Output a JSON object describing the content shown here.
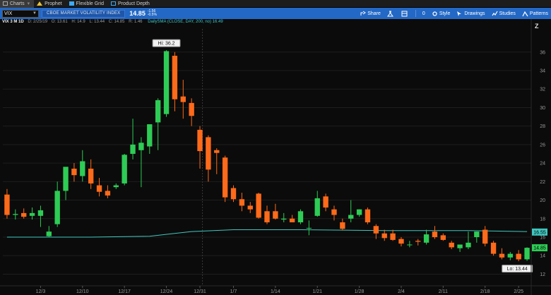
{
  "tabs": [
    {
      "label": "Charts",
      "icon": "charts-icon",
      "active": true
    },
    {
      "label": "Prophet",
      "icon": "warning-icon",
      "active": false
    },
    {
      "label": "Flexible Grid",
      "icon": "grid-icon",
      "active": false
    },
    {
      "label": "Product Depth",
      "icon": "depth-icon",
      "active": false
    }
  ],
  "toolbar": {
    "symbol": "VIX",
    "description": "CBOE MARKET VOLATILITY INDEX",
    "last_price": "14.85",
    "change_top": "-1.56",
    "change_bottom": "-0.5%",
    "share": "Share",
    "count": "0",
    "style": "Style",
    "drawings": "Drawings",
    "studies": "Studies",
    "patterns": "Patterns"
  },
  "chart_header": {
    "symbol_agg": "VIX 3 M 1D",
    "date": "D: 2/25/19",
    "open": "O: 13.61",
    "high": "H: 14.9",
    "low": "L: 13.44",
    "close": "C: 14.85",
    "change": "R: 1.46",
    "sma": "DailySMA (CLOSE, DAY, 200, no) 16.49"
  },
  "colors": {
    "up": "#2ecc55",
    "down": "#ff6a1a",
    "sma": "#40c8c0",
    "grid": "#1e1e1e",
    "bg": "#0b0b0b"
  },
  "chart_data": {
    "type": "candlestick",
    "y_ticks": [
      12,
      14,
      16,
      18,
      20,
      22,
      24,
      26,
      28,
      30,
      32,
      34,
      36
    ],
    "ylim": [
      11.5,
      38.5
    ],
    "x_tick_labels": [
      {
        "label": "12/3",
        "index": 4
      },
      {
        "label": "12/10",
        "index": 9
      },
      {
        "label": "12/17",
        "index": 14
      },
      {
        "label": "12/24",
        "index": 19
      },
      {
        "label": "12/31",
        "index": 23
      },
      {
        "label": "1/7",
        "index": 27
      },
      {
        "label": "1/14",
        "index": 32
      },
      {
        "label": "1/21",
        "index": 37
      },
      {
        "label": "1/28",
        "index": 42
      },
      {
        "label": "2/4",
        "index": 47
      },
      {
        "label": "2/11",
        "index": 52
      },
      {
        "label": "2/18",
        "index": 57
      },
      {
        "label": "2/25",
        "index": 61
      }
    ],
    "candles": [
      {
        "o": 20.6,
        "h": 21.2,
        "l": 18.0,
        "c": 18.4
      },
      {
        "o": 18.4,
        "h": 19.0,
        "l": 17.9,
        "c": 18.5
      },
      {
        "o": 18.6,
        "h": 19.1,
        "l": 18.0,
        "c": 18.2
      },
      {
        "o": 18.3,
        "h": 19.2,
        "l": 17.9,
        "c": 18.6
      },
      {
        "o": 18.3,
        "h": 19.4,
        "l": 17.1,
        "c": 18.9
      },
      {
        "o": 16.1,
        "h": 17.2,
        "l": 16.0,
        "c": 16.6
      },
      {
        "o": 17.4,
        "h": 22.0,
        "l": 17.1,
        "c": 21.0
      },
      {
        "o": 21.0,
        "h": 23.2,
        "l": 20.0,
        "c": 23.6
      },
      {
        "o": 23.4,
        "h": 24.0,
        "l": 22.0,
        "c": 22.7
      },
      {
        "o": 22.6,
        "h": 25.4,
        "l": 22.0,
        "c": 24.2
      },
      {
        "o": 23.4,
        "h": 24.4,
        "l": 21.2,
        "c": 21.8
      },
      {
        "o": 21.6,
        "h": 22.4,
        "l": 20.4,
        "c": 20.9
      },
      {
        "o": 21.0,
        "h": 21.6,
        "l": 20.2,
        "c": 20.5
      },
      {
        "o": 21.4,
        "h": 21.8,
        "l": 21.2,
        "c": 21.6
      },
      {
        "o": 21.8,
        "h": 25.0,
        "l": 21.6,
        "c": 24.9
      },
      {
        "o": 25.0,
        "h": 28.8,
        "l": 24.4,
        "c": 26.0
      },
      {
        "o": 25.4,
        "h": 26.8,
        "l": 21.4,
        "c": 26.2
      },
      {
        "o": 25.8,
        "h": 27.8,
        "l": 25.0,
        "c": 28.2
      },
      {
        "o": 28.4,
        "h": 31.0,
        "l": 25.4,
        "c": 30.8
      },
      {
        "o": 29.3,
        "h": 36.2,
        "l": 29.0,
        "c": 36.1
      },
      {
        "o": 35.6,
        "h": 36.0,
        "l": 29.6,
        "c": 30.9
      },
      {
        "o": 31.2,
        "h": 33.0,
        "l": 28.8,
        "c": 30.6
      },
      {
        "o": 30.5,
        "h": 31.0,
        "l": 28.0,
        "c": 29.1
      },
      {
        "o": 27.6,
        "h": 28.0,
        "l": 23.4,
        "c": 25.3
      },
      {
        "o": 26.8,
        "h": 27.0,
        "l": 22.0,
        "c": 23.3
      },
      {
        "o": 25.4,
        "h": 25.6,
        "l": 22.8,
        "c": 25.1
      },
      {
        "o": 24.6,
        "h": 24.8,
        "l": 19.8,
        "c": 20.3
      },
      {
        "o": 21.3,
        "h": 21.6,
        "l": 19.8,
        "c": 20.1
      },
      {
        "o": 20.1,
        "h": 20.8,
        "l": 18.8,
        "c": 19.4
      },
      {
        "o": 19.4,
        "h": 19.8,
        "l": 18.6,
        "c": 19.0
      },
      {
        "o": 20.7,
        "h": 20.8,
        "l": 18.0,
        "c": 18.1
      },
      {
        "o": 18.8,
        "h": 19.4,
        "l": 17.4,
        "c": 17.6
      },
      {
        "o": 18.8,
        "h": 19.6,
        "l": 17.9,
        "c": 18.0
      },
      {
        "o": 17.9,
        "h": 18.6,
        "l": 17.6,
        "c": 18.0
      },
      {
        "o": 18.0,
        "h": 18.4,
        "l": 17.6,
        "c": 17.6
      },
      {
        "o": 17.6,
        "h": 19.0,
        "l": 17.4,
        "c": 18.8
      },
      {
        "o": 17.0,
        "h": 17.8,
        "l": 16.2,
        "c": 17.0
      },
      {
        "o": 18.3,
        "h": 21.0,
        "l": 18.2,
        "c": 20.2
      },
      {
        "o": 20.4,
        "h": 20.7,
        "l": 18.8,
        "c": 19.2
      },
      {
        "o": 19.0,
        "h": 19.4,
        "l": 17.8,
        "c": 18.4
      },
      {
        "o": 17.6,
        "h": 18.0,
        "l": 16.8,
        "c": 16.9
      },
      {
        "o": 18.0,
        "h": 20.0,
        "l": 17.6,
        "c": 18.4
      },
      {
        "o": 18.4,
        "h": 19.0,
        "l": 18.2,
        "c": 19.0
      },
      {
        "o": 19.0,
        "h": 19.2,
        "l": 17.4,
        "c": 17.6
      },
      {
        "o": 17.2,
        "h": 17.4,
        "l": 15.8,
        "c": 16.4
      },
      {
        "o": 16.4,
        "h": 16.8,
        "l": 15.6,
        "c": 15.9
      },
      {
        "o": 16.4,
        "h": 16.8,
        "l": 15.6,
        "c": 15.7
      },
      {
        "o": 15.8,
        "h": 16.0,
        "l": 15.0,
        "c": 15.3
      },
      {
        "o": 15.2,
        "h": 15.6,
        "l": 14.9,
        "c": 15.2
      },
      {
        "o": 15.6,
        "h": 15.8,
        "l": 15.1,
        "c": 15.5
      },
      {
        "o": 15.4,
        "h": 16.8,
        "l": 15.2,
        "c": 16.3
      },
      {
        "o": 16.6,
        "h": 17.2,
        "l": 15.8,
        "c": 16.0
      },
      {
        "o": 16.2,
        "h": 16.4,
        "l": 15.6,
        "c": 15.7
      },
      {
        "o": 15.4,
        "h": 15.6,
        "l": 14.7,
        "c": 14.9
      },
      {
        "o": 14.8,
        "h": 15.2,
        "l": 14.4,
        "c": 15.2
      },
      {
        "o": 14.9,
        "h": 16.6,
        "l": 14.7,
        "c": 15.4
      },
      {
        "o": 16.0,
        "h": 16.6,
        "l": 15.4,
        "c": 16.6
      },
      {
        "o": 16.8,
        "h": 17.2,
        "l": 15.0,
        "c": 15.3
      },
      {
        "o": 15.4,
        "h": 15.6,
        "l": 14.0,
        "c": 14.2
      },
      {
        "o": 14.2,
        "h": 14.8,
        "l": 13.6,
        "c": 13.8
      },
      {
        "o": 13.8,
        "h": 14.4,
        "l": 13.5,
        "c": 14.2
      },
      {
        "o": 14.2,
        "h": 14.6,
        "l": 13.4,
        "c": 13.6
      },
      {
        "o": 13.6,
        "h": 14.9,
        "l": 13.44,
        "c": 14.85
      }
    ],
    "sma_points": [
      {
        "i": 0,
        "v": 16.0
      },
      {
        "i": 10,
        "v": 16.0
      },
      {
        "i": 17,
        "v": 16.1
      },
      {
        "i": 22,
        "v": 16.6
      },
      {
        "i": 27,
        "v": 16.8
      },
      {
        "i": 35,
        "v": 16.8
      },
      {
        "i": 45,
        "v": 16.7
      },
      {
        "i": 55,
        "v": 16.7
      },
      {
        "i": 62,
        "v": 16.6
      }
    ],
    "hi_label": "Hi: 36.2",
    "lo_label": "Lo: 13.44",
    "price_labels": [
      {
        "text": "16.55",
        "v": 16.55,
        "color": "#40c8c0"
      },
      {
        "text": "14.85",
        "v": 14.85,
        "color": "#2ecc55"
      }
    ]
  }
}
